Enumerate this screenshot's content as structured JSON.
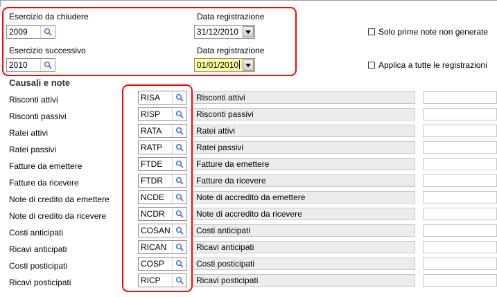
{
  "header": {
    "esercizio_chiudere_label": "Esercizio da chiudere",
    "esercizio_chiudere_value": "2009",
    "data_reg_label_1": "Data registrazione",
    "data_reg_value_1": "31/12/2010",
    "esercizio_successivo_label": "Esercizio successivo",
    "esercizio_successivo_value": "2010",
    "data_reg_label_2": "Data registrazione",
    "data_reg_value_2": "01/01/2010",
    "solo_prime_note_label": "Solo prime note non generate",
    "applica_label": "Applica a tutte le registrazioni"
  },
  "section_title": "Causali e note",
  "rows": [
    {
      "label": "Risconti attivi",
      "code": "RISA",
      "desc": "Risconti attivi"
    },
    {
      "label": "Risconti passivi",
      "code": "RISP",
      "desc": "Risconti passivi"
    },
    {
      "label": "Ratei attivi",
      "code": "RATA",
      "desc": "Ratei attivi"
    },
    {
      "label": "Ratei passivi",
      "code": "RATP",
      "desc": "Ratei passivi"
    },
    {
      "label": "Fatture da emettere",
      "code": "FTDE",
      "desc": "Fatture da emettere"
    },
    {
      "label": "Fatture da ricevere",
      "code": "FTDR",
      "desc": "Fatture da ricevere"
    },
    {
      "label": "Note di credito da emettere",
      "code": "NCDE",
      "desc": "Note di accredito da emettere"
    },
    {
      "label": "Note di credito da ricevere",
      "code": "NCDR",
      "desc": "Note di accredito da ricevere"
    },
    {
      "label": "Costi anticipati",
      "code": "COSAN",
      "desc": "Costi anticipati"
    },
    {
      "label": "Ricavi anticipati",
      "code": "RICAN",
      "desc": "Ricavi anticipati"
    },
    {
      "label": "Costi posticipati",
      "code": "COSP",
      "desc": "Costi posticipati"
    },
    {
      "label": "Ricavi posticipati",
      "code": "RICP",
      "desc": "Ricavi posticipati"
    }
  ],
  "icons": {
    "lookup": "magnifier-icon",
    "dropdown": "chevron-down-icon"
  },
  "colors": {
    "highlight": "#ffff9c",
    "annotation": "#ff0000",
    "magnifier": "#2a6fc9"
  }
}
